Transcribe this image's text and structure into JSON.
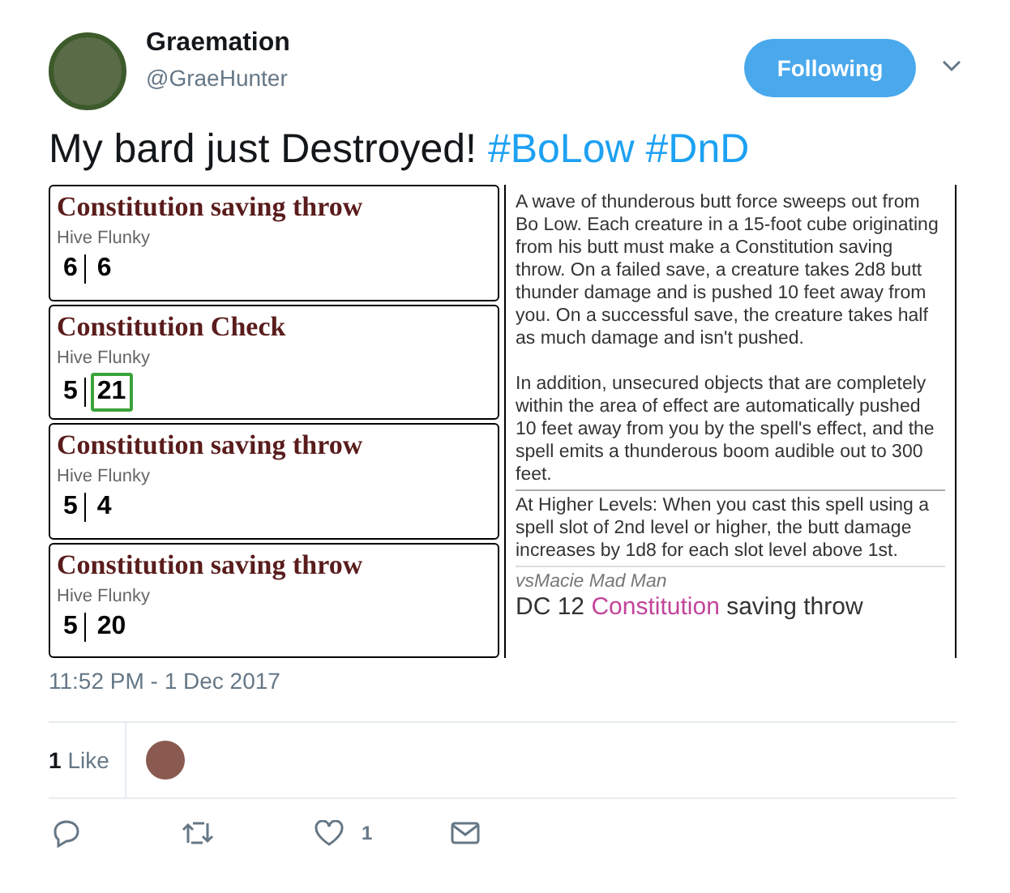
{
  "author": {
    "name": "Graemation",
    "handle": "@GraeHunter"
  },
  "follow_button": {
    "label": "Following"
  },
  "tweet": {
    "text": "My bard just Destroyed!",
    "hashtags": [
      "#BoLow",
      "#DnD"
    ]
  },
  "rolls": [
    {
      "title": "Constitution saving throw",
      "target": "Hive Flunky",
      "first": "6",
      "second": "6",
      "highlighted": false
    },
    {
      "title": "Constitution Check",
      "target": "Hive Flunky",
      "first": "5",
      "second": "21",
      "highlighted": true
    },
    {
      "title": "Constitution saving throw",
      "target": "Hive Flunky",
      "first": "5",
      "second": "4",
      "highlighted": false
    },
    {
      "title": "Constitution saving throw",
      "target": "Hive Flunky",
      "first": "5",
      "second": "20",
      "highlighted": false
    }
  ],
  "spell": {
    "paragraphs": [
      "A wave of thunderous butt force sweeps out from Bo Low. Each creature in a 15-foot cube originating from his butt must make a Constitution saving throw. On a failed save, a creature takes 2d8 butt thunder damage and is pushed 10 feet away from you. On a successful save, the creature takes half as much damage and isn't pushed.",
      "In addition, unsecured objects that are completely within the area of effect are automatically pushed 10 feet away from you by the spell's effect, and the spell emits a thunderous boom audible out to 300 feet."
    ],
    "higher_levels": "At Higher Levels: When you cast this spell using a spell slot of 2nd level or higher, the butt damage increases by 1d8 for each slot level above 1st.",
    "target": "vsMacie Mad Man",
    "dc": "DC 12",
    "dc_link": "Constitution",
    "dc_rest": "saving throw"
  },
  "timestamp": "11:52 PM - 1 Dec 2017",
  "likes": {
    "count": "1",
    "label": "Like"
  },
  "actions": {
    "like_count": "1"
  }
}
